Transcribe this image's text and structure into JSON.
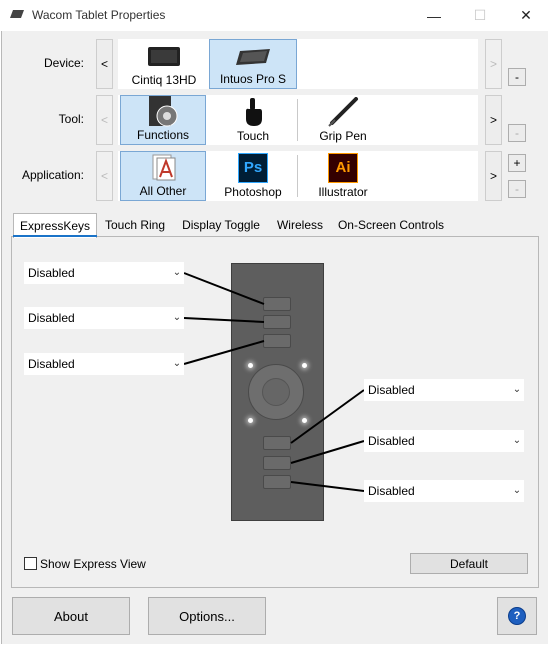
{
  "window": {
    "title": "Wacom Tablet Properties",
    "minimize": "—",
    "maximize": "☐",
    "close": "✕"
  },
  "device": {
    "label": "Device:",
    "prev": "<",
    "next": ">",
    "remove": "-",
    "items": [
      {
        "label": "Cintiq 13HD",
        "icon": "tablet-display-icon",
        "selected": false
      },
      {
        "label": "Intuos Pro S",
        "icon": "tablet-icon",
        "selected": true
      }
    ]
  },
  "tool": {
    "label": "Tool:",
    "prev": "<",
    "next": ">",
    "remove": "-",
    "items": [
      {
        "label": "Functions",
        "icon": "functions-icon",
        "selected": true
      },
      {
        "label": "Touch",
        "icon": "touch-hand-icon",
        "selected": false
      },
      {
        "label": "Grip Pen",
        "icon": "pen-icon",
        "selected": false
      }
    ]
  },
  "application": {
    "label": "Application:",
    "prev": "<",
    "next": ">",
    "add": "+",
    "remove": "-",
    "items": [
      {
        "label": "All Other",
        "icon": "all-other-apps-icon",
        "selected": true
      },
      {
        "label": "Photoshop",
        "icon": "photoshop-icon",
        "icon_text": "Ps",
        "selected": false
      },
      {
        "label": "Illustrator",
        "icon": "illustrator-icon",
        "icon_text": "Ai",
        "selected": false
      }
    ]
  },
  "tabs": [
    {
      "label": "ExpressKeys",
      "active": true
    },
    {
      "label": "Touch Ring",
      "active": false
    },
    {
      "label": "Display Toggle",
      "active": false
    },
    {
      "label": "Wireless",
      "active": false
    },
    {
      "label": "On-Screen Controls",
      "active": false
    }
  ],
  "expresskeys": {
    "left": [
      "Disabled",
      "Disabled",
      "Disabled"
    ],
    "right": [
      "Disabled",
      "Disabled",
      "Disabled"
    ],
    "show_express_view": "Show Express View",
    "show_express_view_checked": false,
    "default_button": "Default"
  },
  "footer": {
    "about": "About",
    "options": "Options...",
    "help_icon": "help-icon",
    "help_glyph": "?"
  },
  "colors": {
    "selection_bg": "#cde4f7",
    "selection_border": "#7aa7d4",
    "tab_accent": "#1a73c8",
    "photoshop_bg": "#001e36",
    "photoshop_fg": "#31a8ff",
    "illustrator_bg": "#330000",
    "illustrator_fg": "#ff9a00"
  }
}
